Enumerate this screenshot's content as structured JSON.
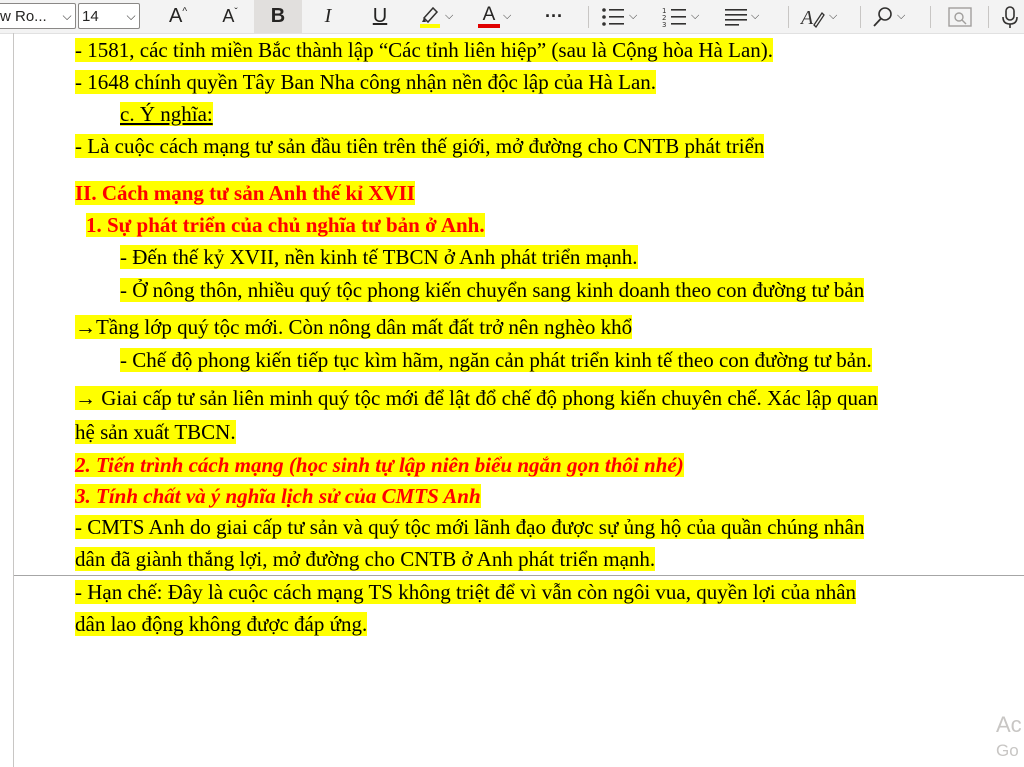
{
  "toolbar": {
    "font_name": "w Ro...",
    "font_size": "14",
    "icons": {
      "grow_font": "A",
      "shrink_font": "A",
      "bold": "B",
      "italic": "I",
      "underline": "U",
      "font_color_letter": "A",
      "more": "···"
    },
    "colors": {
      "highlight": "#ffff00",
      "font_color": "#e00000",
      "pressed_bg": "#e1dfdd"
    }
  },
  "document": {
    "lines": [
      {
        "text": "-  1581, các tỉnh miền Bắc thành lập “Các tỉnh liên hiệp” (sau là Cộng hòa Hà Lan)."
      },
      {
        "text": "- 1648 chính quyền Tây Ban Nha công nhận nền độc lập của Hà Lan."
      },
      {
        "text": "c. Ý nghĩa: "
      },
      {
        "text": "- Là cuộc cách mạng tư sản đầu tiên trên thế giới, mở đường cho CNTB phát triển"
      },
      {
        "text": "II. Cách mạng tư sản Anh thế kỉ XVII"
      },
      {
        "text": "1. Sự phát triển của chủ nghĩa tư bản ở Anh."
      },
      {
        "text": "- Đến thế kỷ XVII, nền kinh tế TBCN ở Anh phát triển mạnh."
      },
      {
        "text": "- Ở nông thôn, nhiều quý tộc phong kiến chuyển sang kinh doanh theo con đường tư bản"
      },
      {
        "text": "→Tầng lớp quý tộc mới. Còn nông dân mất đất trở nên nghèo khổ"
      },
      {
        "text": "- Chế độ phong kiến tiếp tục kìm hãm, ngăn cản phát triển kinh tế theo con đường tư bản."
      },
      {
        "text": "→ Giai cấp tư sản liên minh quý tộc mới để lật đổ chế độ phong kiến chuyên chế. Xác lập quan"
      },
      {
        "text": "hệ sản xuất TBCN."
      },
      {
        "text": "2. Tiến trình cách mạng  (học sinh tự lập niên biểu ngắn gọn thôi nhé)"
      },
      {
        "text": "3. Tính chất và ý nghĩa lịch sử của CMTS Anh"
      },
      {
        "text": "- CMTS Anh do giai cấp tư sản và quý tộc mới lãnh đạo được sự ủng hộ của quần chúng nhân"
      },
      {
        "text": "dân đã giành thắng lợi, mở đường cho CNTB ở Anh phát triển mạnh."
      },
      {
        "text": "- Hạn chế: Đây là cuộc cách mạng TS không triệt để vì vẫn còn ngôi vua,  quyền lợi của nhân"
      },
      {
        "text": "dân lao động không được đáp ứng."
      }
    ]
  },
  "watermark": {
    "line1": "Ac",
    "line2": "Go"
  }
}
